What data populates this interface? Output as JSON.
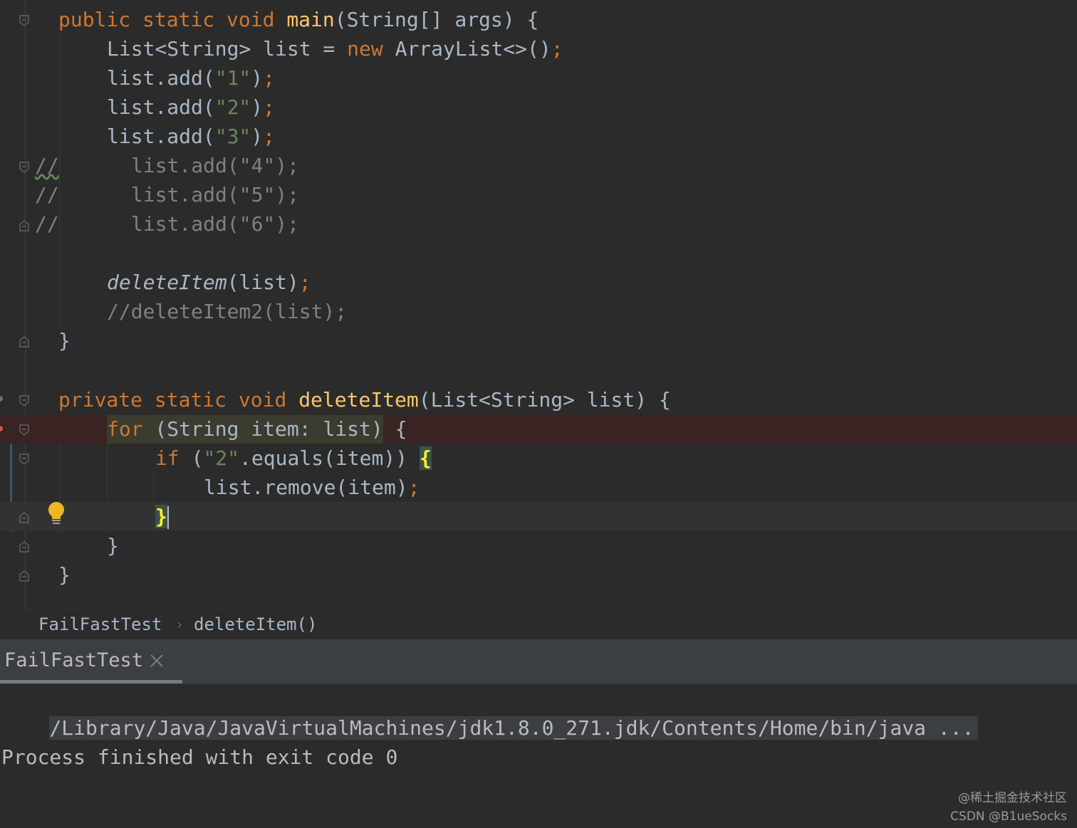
{
  "editor": {
    "lines": {
      "l1": {
        "kw1": "public",
        "kw2": "static",
        "kw3": "void",
        "fn": "main",
        "rest": "(String[] args) {"
      },
      "l2": {
        "a": "List<String> list = ",
        "kw": "new",
        "b": " ArrayList<>()",
        "semi": ";"
      },
      "l3": {
        "a": "list.add(",
        "s": "\"1\"",
        "b": ")",
        "semi": ";"
      },
      "l4": {
        "a": "list.add(",
        "s": "\"2\"",
        "b": ")",
        "semi": ";"
      },
      "l5": {
        "a": "list.add(",
        "s": "\"3\"",
        "b": ")",
        "semi": ";"
      },
      "l6": {
        "prefix": "//",
        "code": "list.add(\"4\");"
      },
      "l7": {
        "prefix": "//",
        "code": "list.add(\"5\");"
      },
      "l8": {
        "prefix": "//",
        "code": "list.add(\"6\");"
      },
      "l10": {
        "call": "deleteItem",
        "args": "(list)",
        "semi": ";"
      },
      "l11": {
        "comment": "//deleteItem2(list);"
      },
      "l12": {
        "brace": "}"
      },
      "l14": {
        "kw1": "private",
        "kw2": "static",
        "kw3": "void",
        "fn": "deleteItem",
        "rest": "(List<String> list) {"
      },
      "l15": {
        "kw": "for",
        "rest": " (String item: list)",
        "brace": " {"
      },
      "l16": {
        "kw": "if",
        "a": " (",
        "s": "\"2\"",
        "b": ".equals(item)) ",
        "brace": "{"
      },
      "l17": {
        "a": "list.remove(item)",
        "semi": ";"
      },
      "l18": {
        "brace": "}"
      },
      "l19": {
        "brace": "}"
      },
      "l20": {
        "brace": "}"
      }
    }
  },
  "breadcrumb": {
    "class_name": "FailFastTest",
    "separator": "›",
    "method_name": "deleteItem()"
  },
  "run_panel": {
    "tab_label": "FailFastTest",
    "console": {
      "command": "/Library/Java/JavaVirtualMachines/jdk1.8.0_271.jdk/Contents/Home/bin/java ...",
      "exit_message": "Process finished with exit code 0"
    }
  },
  "watermark": {
    "line1": "@稀土掘金技术社区",
    "line2": "CSDN @B1ueSocks"
  },
  "colors": {
    "background": "#2b2b2b",
    "keyword": "#cc7832",
    "function": "#ffc66d",
    "string": "#6a8759",
    "comment": "#808080",
    "text": "#a9b7c6",
    "error_line": "#3a2323",
    "brace_match": "#ffef28"
  }
}
